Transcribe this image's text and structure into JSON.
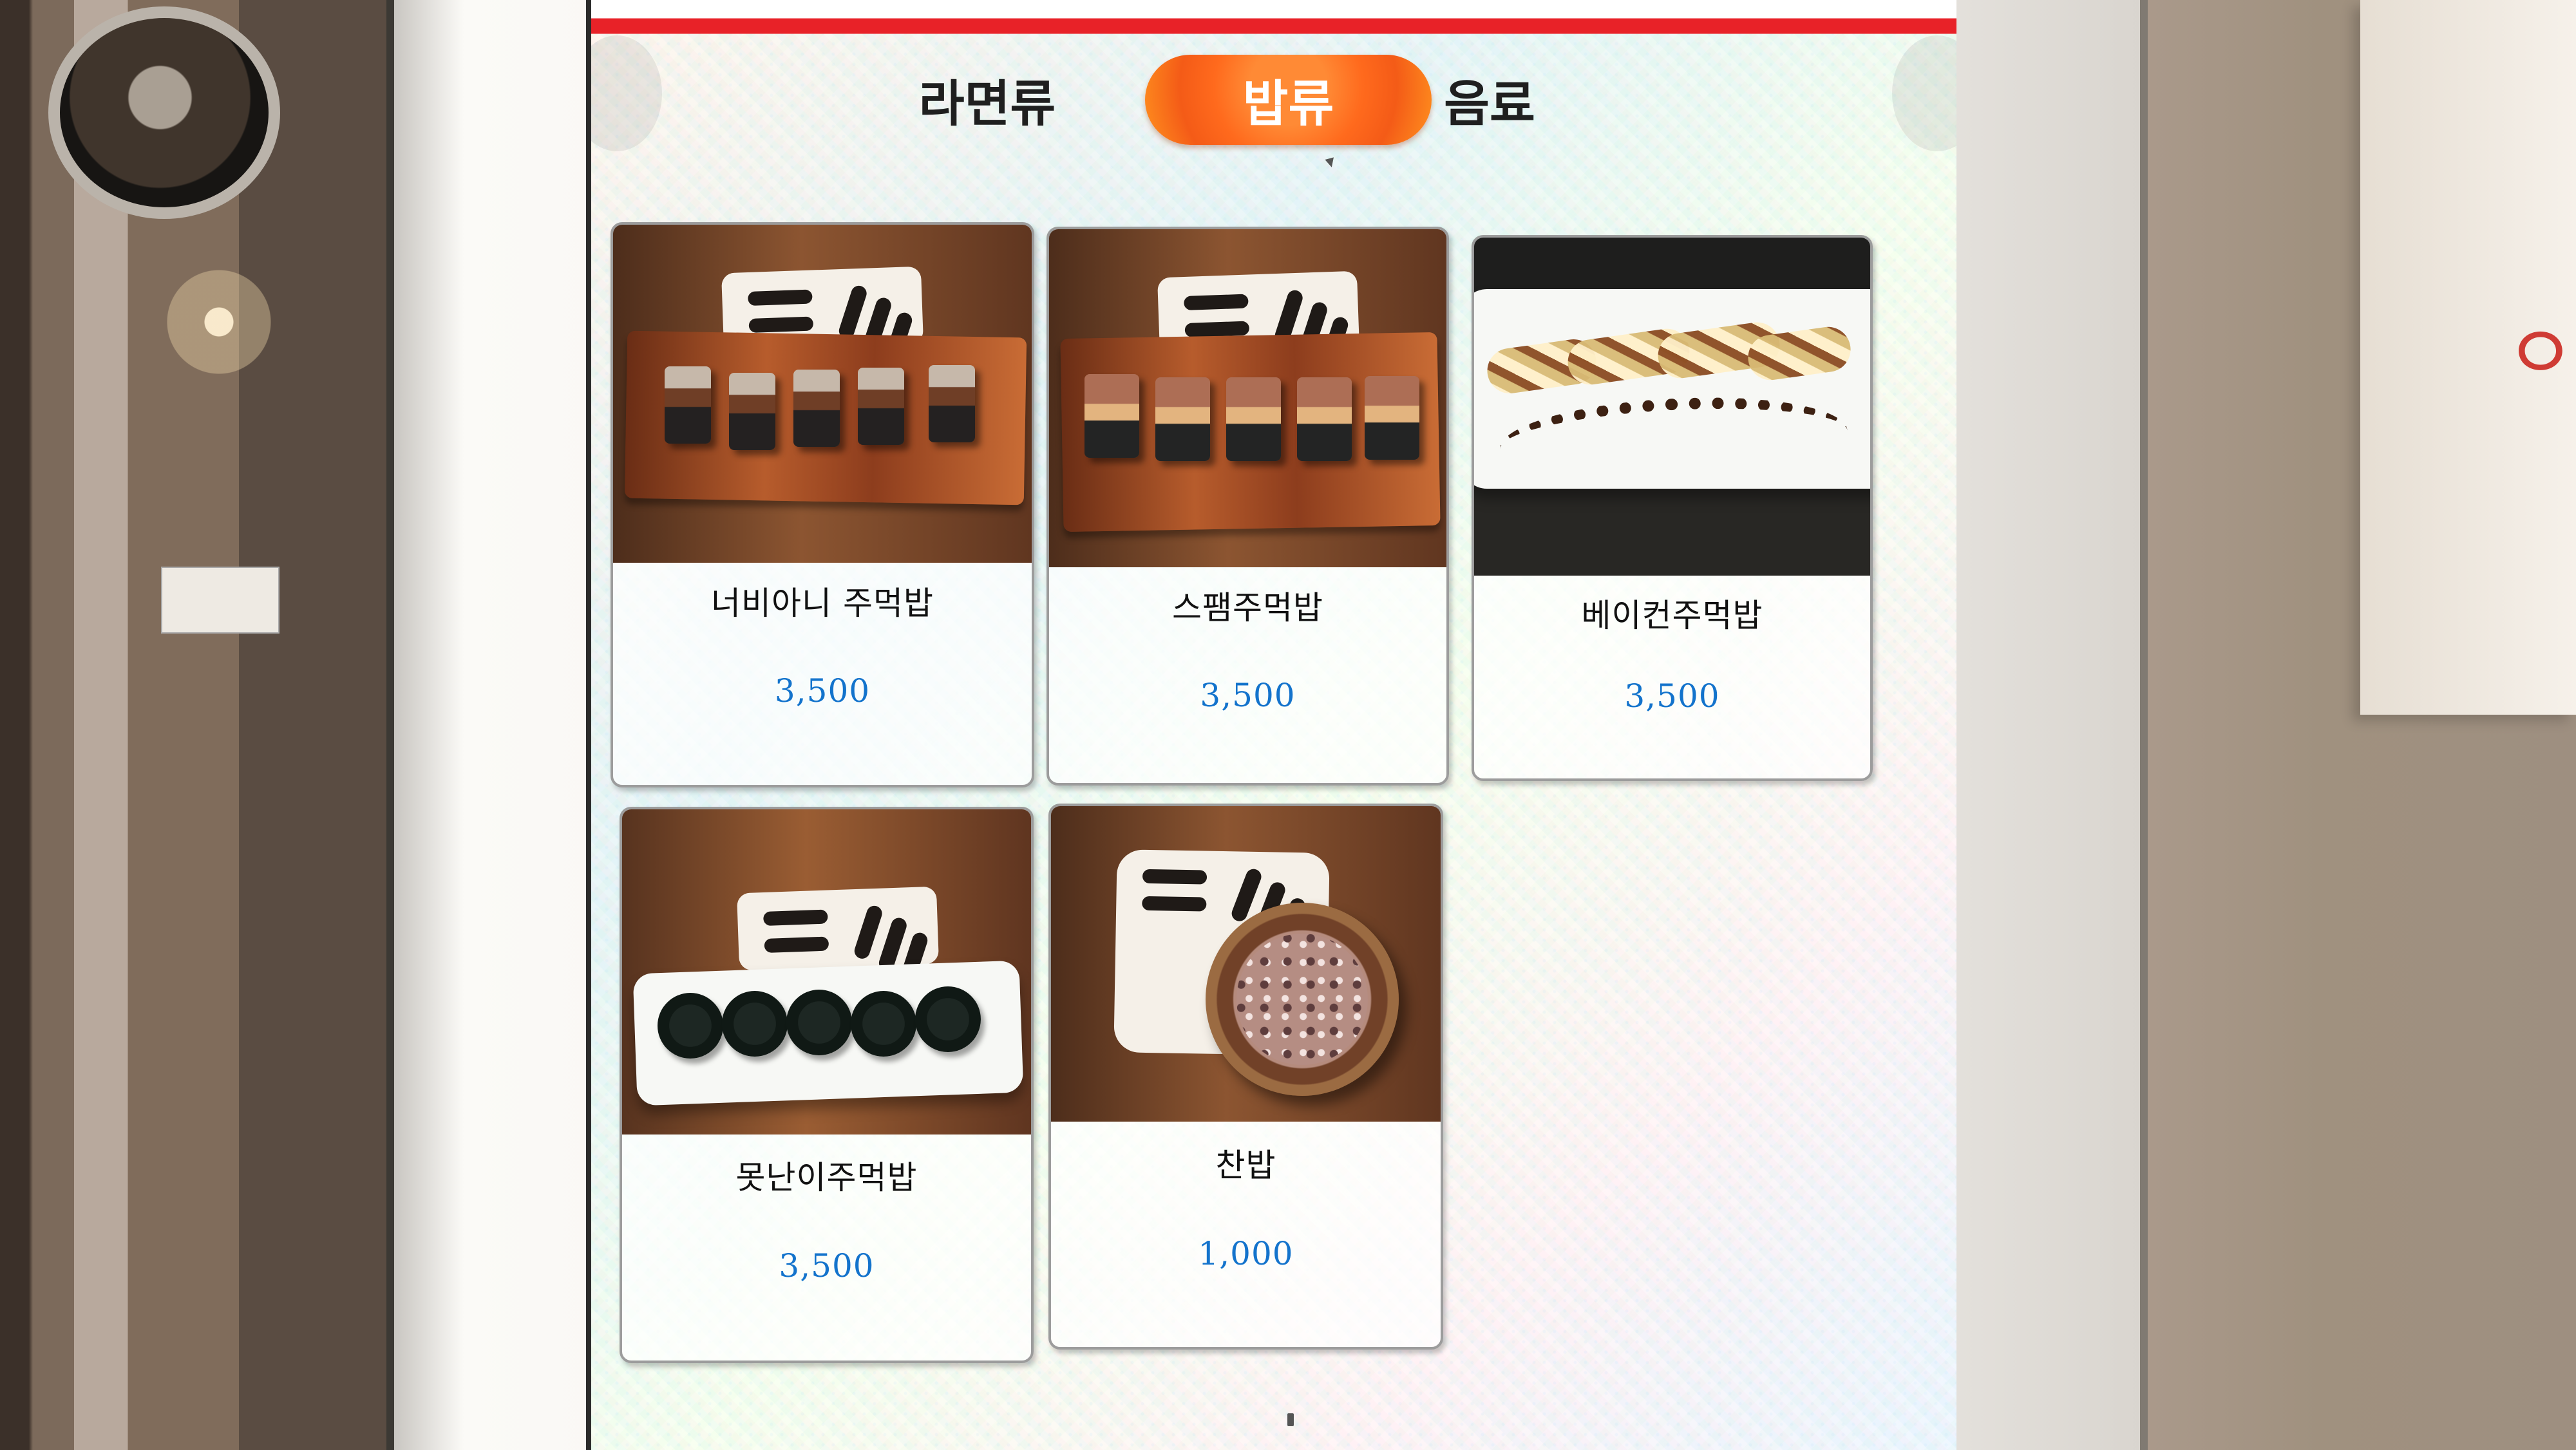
{
  "menu": {
    "tabs": [
      {
        "label": "라면류",
        "active": false
      },
      {
        "label": "밥류",
        "active": true
      },
      {
        "label": "음료",
        "active": false
      }
    ],
    "items": [
      {
        "name": "너비아니 주먹밥",
        "price": "3,500",
        "image_icon": "ribeye-rice-ball-photo"
      },
      {
        "name": "스팸주먹밥",
        "price": "3,500",
        "image_icon": "spam-rice-ball-photo"
      },
      {
        "name": "베이컨주먹밥",
        "price": "3,500",
        "image_icon": "bacon-rice-ball-photo"
      },
      {
        "name": "못난이주먹밥",
        "price": "3,500",
        "image_icon": "seaweed-rice-ball-photo"
      },
      {
        "name": "찬밥",
        "price": "1,000",
        "image_icon": "cold-rice-bowl-photo"
      }
    ]
  },
  "colors": {
    "active_tab": "#ff6a1d",
    "price": "#1373cc",
    "top_accent": "#e82228"
  }
}
